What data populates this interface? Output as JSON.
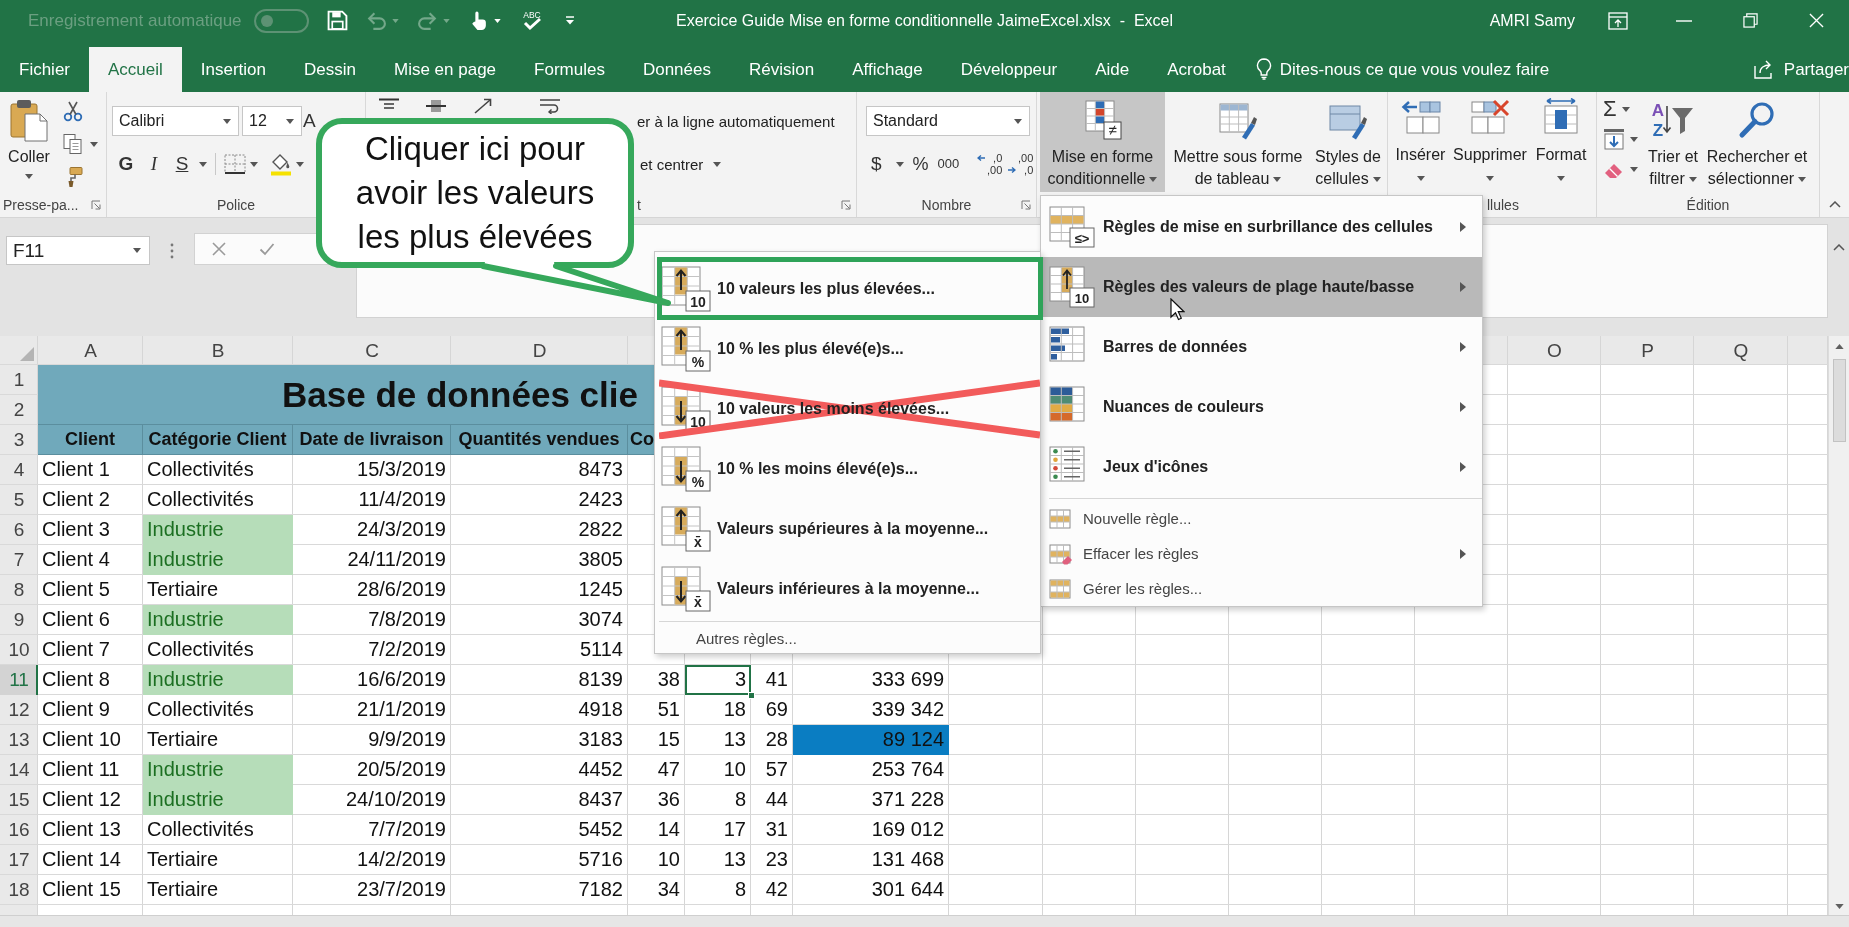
{
  "title_bar": {
    "autosave": {
      "label": "Enregistrement automatique",
      "on": false,
      "disabled": true
    },
    "quick_access": [
      {
        "kind": "save",
        "disabled": false
      },
      {
        "kind": "undo",
        "disabled": true
      },
      {
        "kind": "redo",
        "disabled": true
      },
      {
        "kind": "touch",
        "disabled": false
      },
      {
        "kind": "spelling",
        "text": "ABC",
        "disabled": false
      }
    ],
    "title": "Exercice Guide Mise en forme conditionnelle JaimeExcel.xlsx  -  Excel",
    "user": "AMRI Samy"
  },
  "tabs": [
    {
      "label": "Fichier",
      "selected": false
    },
    {
      "label": "Accueil",
      "selected": true
    },
    {
      "label": "Insertion",
      "selected": false
    },
    {
      "label": "Dessin",
      "selected": false
    },
    {
      "label": "Mise en page",
      "selected": false
    },
    {
      "label": "Formules",
      "selected": false
    },
    {
      "label": "Données",
      "selected": false
    },
    {
      "label": "Révision",
      "selected": false
    },
    {
      "label": "Affichage",
      "selected": false
    },
    {
      "label": "Développeur",
      "selected": false
    },
    {
      "label": "Aide",
      "selected": false
    },
    {
      "label": "Acrobat",
      "selected": false
    }
  ],
  "tell_me": {
    "placeholder": "Dites-nous ce que vous voulez faire"
  },
  "share": "Partager",
  "ribbon": {
    "clipboard": {
      "paste": "Coller",
      "label": "Presse-pa..."
    },
    "font": {
      "name": "Calibri",
      "size": "12",
      "grow": "A",
      "bold": "G",
      "italic": "I",
      "underline": "S",
      "label": "Police"
    },
    "alignment": {
      "wrap": "er à la ligne automatiquement",
      "merge": "et centrer",
      "label": "t"
    },
    "number": {
      "format": "Standard",
      "currency": "$",
      "percent": "%",
      "thousands": "000",
      "decimals": [
        ",0 ,00",
        ",00 ,0"
      ],
      "label": "Nombre"
    },
    "styles": [
      {
        "label": "Mise en forme conditionnelle",
        "badge": "≠",
        "selected": true
      },
      {
        "label": "Mettre sous forme de tableau",
        "selected": false
      },
      {
        "label": "Styles de cellules",
        "selected": false
      }
    ],
    "cells": {
      "buttons": [
        "Insérer",
        "Supprimer",
        "Format"
      ],
      "label": "llules"
    },
    "editing": {
      "autosum": "Σ",
      "sort_letters": [
        "A",
        "Z"
      ],
      "sort": "Trier et filtrer",
      "find": "Rechercher et sélectionner",
      "label": "Édition"
    }
  },
  "formula_bar": {
    "name_box": "F11"
  },
  "conditional_menu": {
    "items": [
      {
        "kind": "rule_set",
        "label": "Règles de mise en surbrillance des cellules",
        "badge": "≤>",
        "selected": false,
        "has_submenu": true
      },
      {
        "kind": "rule_set",
        "label": "Règles des valeurs de plage haute/basse",
        "badge": "10",
        "selected": true,
        "has_submenu": true
      },
      {
        "kind": "rule_set",
        "label": "Barres de données",
        "selected": false,
        "has_submenu": true
      },
      {
        "kind": "rule_set",
        "label": "Nuances de couleurs",
        "selected": false,
        "has_submenu": true
      },
      {
        "kind": "rule_set",
        "label": "Jeux d'icônes",
        "selected": false,
        "has_submenu": true
      },
      {
        "kind": "command",
        "label": "Nouvelle règle...",
        "selected": false,
        "has_submenu": false
      },
      {
        "kind": "command",
        "label": "Effacer les règles",
        "selected": false,
        "has_submenu": true
      },
      {
        "kind": "command",
        "label": "Gérer les règles...",
        "selected": false,
        "has_submenu": false
      }
    ]
  },
  "submenu": {
    "items": [
      {
        "kind": "rule",
        "label": "10 valeurs les plus élevées...",
        "badge": "10",
        "outlined": true,
        "crossed_out": false
      },
      {
        "kind": "rule",
        "label": "10 % les plus élevé(e)s...",
        "badge": "%",
        "outlined": false,
        "crossed_out": false
      },
      {
        "kind": "rule",
        "label": "10 valeurs les moins élevées...",
        "badge": "10",
        "outlined": false,
        "crossed_out": true
      },
      {
        "kind": "rule",
        "label": "10 % les moins élevé(e)s...",
        "badge": "%",
        "outlined": false,
        "crossed_out": false
      },
      {
        "kind": "rule",
        "label": "Valeurs supérieures à la moyenne...",
        "badge": "x̄",
        "outlined": false,
        "crossed_out": false
      },
      {
        "kind": "rule",
        "label": "Valeurs inférieures à la moyenne...",
        "badge": "x̄",
        "outlined": false,
        "crossed_out": false
      },
      {
        "kind": "command",
        "label": "Autres règles...",
        "outlined": false,
        "crossed_out": false
      }
    ]
  },
  "callout": "Cliquer ici pour avoir les valeurs les plus élevées",
  "sheet": {
    "columns": {
      "left": [
        "A",
        "B",
        "C",
        "D"
      ],
      "right": [
        "O",
        "P",
        "Q"
      ]
    },
    "title": "Base de données clie",
    "rows": [
      {
        "number": "1",
        "selected": false,
        "kind": "title"
      },
      {
        "number": "2",
        "selected": false,
        "kind": "title"
      },
      {
        "number": "3",
        "selected": false,
        "kind": "header",
        "cells": [
          {
            "text": "Client",
            "selected": false
          },
          {
            "text": "Catégorie Client",
            "selected": false
          },
          {
            "text": "Date de livraison",
            "selected": false
          },
          {
            "text": "Quantités vendues",
            "selected": false
          },
          {
            "text": "Co",
            "selected": false
          }
        ]
      },
      {
        "number": "4",
        "selected": false,
        "kind": "data",
        "cells": [
          {
            "text": "Client 1",
            "selected": false
          },
          {
            "text": "Collectivités",
            "selected": false
          },
          {
            "text": "15/3/2019",
            "selected": false
          },
          {
            "text": "8473",
            "selected": false
          }
        ]
      },
      {
        "number": "5",
        "selected": false,
        "kind": "data",
        "cells": [
          {
            "text": "Client 2",
            "selected": false
          },
          {
            "text": "Collectivités",
            "selected": false
          },
          {
            "text": "11/4/2019",
            "selected": false
          },
          {
            "text": "2423",
            "selected": false
          }
        ]
      },
      {
        "number": "6",
        "selected": false,
        "kind": "data",
        "cells": [
          {
            "text": "Client 3",
            "selected": false
          },
          {
            "text": "Industrie",
            "selected": false,
            "color": "#b6ddb9"
          },
          {
            "text": "24/3/2019",
            "selected": false
          },
          {
            "text": "2822",
            "selected": false
          }
        ]
      },
      {
        "number": "7",
        "selected": false,
        "kind": "data",
        "cells": [
          {
            "text": "Client 4",
            "selected": false
          },
          {
            "text": "Industrie",
            "selected": false,
            "color": "#b6ddb9"
          },
          {
            "text": "24/11/2019",
            "selected": false
          },
          {
            "text": "3805",
            "selected": false
          }
        ]
      },
      {
        "number": "8",
        "selected": false,
        "kind": "data",
        "cells": [
          {
            "text": "Client 5",
            "selected": false
          },
          {
            "text": "Tertiaire",
            "selected": false
          },
          {
            "text": "28/6/2019",
            "selected": false
          },
          {
            "text": "1245",
            "selected": false
          }
        ]
      },
      {
        "number": "9",
        "selected": false,
        "kind": "data",
        "cells": [
          {
            "text": "Client 6",
            "selected": false
          },
          {
            "text": "Industrie",
            "selected": false,
            "color": "#b6ddb9"
          },
          {
            "text": "7/8/2019",
            "selected": false
          },
          {
            "text": "3074",
            "selected": false
          }
        ]
      },
      {
        "number": "10",
        "selected": false,
        "kind": "data",
        "cells": [
          {
            "text": "Client 7",
            "selected": false
          },
          {
            "text": "Collectivités",
            "selected": false
          },
          {
            "text": "7/2/2019",
            "selected": false
          },
          {
            "text": "5114",
            "selected": false
          }
        ]
      },
      {
        "number": "11",
        "selected": true,
        "kind": "data",
        "cells": [
          {
            "text": "Client 8",
            "selected": false
          },
          {
            "text": "Industrie",
            "selected": false,
            "color": "#b6ddb9"
          },
          {
            "text": "16/6/2019",
            "selected": false
          },
          {
            "text": "8139",
            "selected": false
          },
          {
            "text": "38",
            "selected": false
          },
          {
            "text": "3",
            "selected": true
          },
          {
            "text": "41",
            "selected": false
          },
          {
            "text": "333 699",
            "selected": false
          }
        ]
      },
      {
        "number": "12",
        "selected": false,
        "kind": "data",
        "cells": [
          {
            "text": "Client 9",
            "selected": false
          },
          {
            "text": "Collectivités",
            "selected": false
          },
          {
            "text": "21/1/2019",
            "selected": false
          },
          {
            "text": "4918",
            "selected": false
          },
          {
            "text": "51",
            "selected": false
          },
          {
            "text": "18",
            "selected": false
          },
          {
            "text": "69",
            "selected": false
          },
          {
            "text": "339 342",
            "selected": false
          }
        ]
      },
      {
        "number": "13",
        "selected": false,
        "kind": "data",
        "cells": [
          {
            "text": "Client 10",
            "selected": false
          },
          {
            "text": "Tertiaire",
            "selected": false
          },
          {
            "text": "9/9/2019",
            "selected": false
          },
          {
            "text": "3183",
            "selected": false
          },
          {
            "text": "15",
            "selected": false
          },
          {
            "text": "13",
            "selected": false
          },
          {
            "text": "28",
            "selected": false
          },
          {
            "text": "89 124",
            "selected": false,
            "color": "#0a7dc2"
          }
        ]
      },
      {
        "number": "14",
        "selected": false,
        "kind": "data",
        "cells": [
          {
            "text": "Client 11",
            "selected": false
          },
          {
            "text": "Industrie",
            "selected": false,
            "color": "#b6ddb9"
          },
          {
            "text": "20/5/2019",
            "selected": false
          },
          {
            "text": "4452",
            "selected": false
          },
          {
            "text": "47",
            "selected": false
          },
          {
            "text": "10",
            "selected": false
          },
          {
            "text": "57",
            "selected": false
          },
          {
            "text": "253 764",
            "selected": false
          }
        ]
      },
      {
        "number": "15",
        "selected": false,
        "kind": "data",
        "cells": [
          {
            "text": "Client 12",
            "selected": false
          },
          {
            "text": "Industrie",
            "selected": false,
            "color": "#b6ddb9"
          },
          {
            "text": "24/10/2019",
            "selected": false
          },
          {
            "text": "8437",
            "selected": false
          },
          {
            "text": "36",
            "selected": false
          },
          {
            "text": "8",
            "selected": false
          },
          {
            "text": "44",
            "selected": false
          },
          {
            "text": "371 228",
            "selected": false
          }
        ]
      },
      {
        "number": "16",
        "selected": false,
        "kind": "data",
        "cells": [
          {
            "text": "Client 13",
            "selected": false
          },
          {
            "text": "Collectivités",
            "selected": false
          },
          {
            "text": "7/7/2019",
            "selected": false
          },
          {
            "text": "5452",
            "selected": false
          },
          {
            "text": "14",
            "selected": false
          },
          {
            "text": "17",
            "selected": false
          },
          {
            "text": "31",
            "selected": false
          },
          {
            "text": "169 012",
            "selected": false
          }
        ]
      },
      {
        "number": "17",
        "selected": false,
        "kind": "data",
        "cells": [
          {
            "text": "Client 14",
            "selected": false
          },
          {
            "text": "Tertiaire",
            "selected": false
          },
          {
            "text": "14/2/2019",
            "selected": false
          },
          {
            "text": "5716",
            "selected": false
          },
          {
            "text": "10",
            "selected": false
          },
          {
            "text": "13",
            "selected": false
          },
          {
            "text": "23",
            "selected": false
          },
          {
            "text": "131 468",
            "selected": false
          }
        ]
      },
      {
        "number": "18",
        "selected": false,
        "kind": "data",
        "cells": [
          {
            "text": "Client 15",
            "selected": false
          },
          {
            "text": "Tertiaire",
            "selected": false
          },
          {
            "text": "23/7/2019",
            "selected": false
          },
          {
            "text": "7182",
            "selected": false
          },
          {
            "text": "34",
            "selected": false
          },
          {
            "text": "8",
            "selected": false
          },
          {
            "text": "42",
            "selected": false
          },
          {
            "text": "301 644",
            "selected": false
          }
        ]
      }
    ]
  }
}
